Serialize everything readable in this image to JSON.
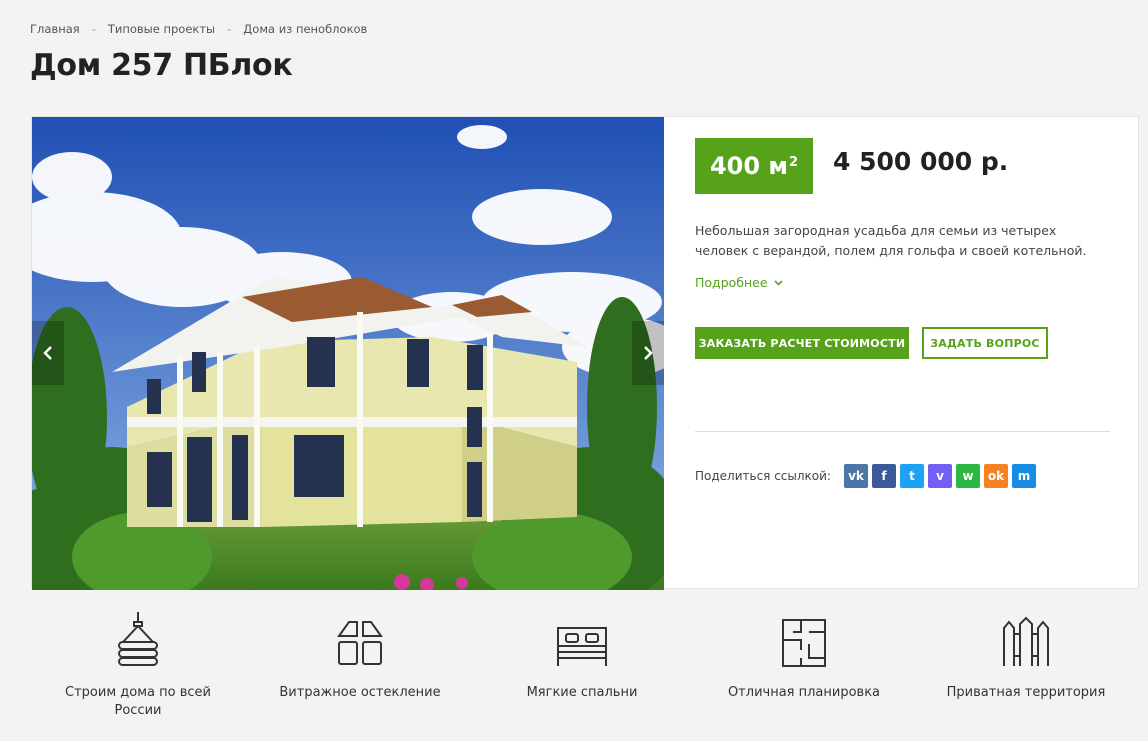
{
  "breadcrumb": [
    "Главная",
    "Типовые проекты",
    "Дома из пеноблоков"
  ],
  "title": "Дом 257 ПБлок",
  "area": "400 м",
  "area_sup": "2",
  "price": "4 500 000 р.",
  "description": "Небольшая загородная усадьба для семьи из четырех человек с верандой, полем для гольфа и своей котельной.",
  "more_label": "Подробнее",
  "buttons": {
    "order": "ЗАКАЗАТЬ РАСЧЕТ СТОИМОСТИ",
    "ask": "ЗАДАТЬ ВОПРОС"
  },
  "share": {
    "label": "Поделиться ссылкой:",
    "networks": [
      {
        "name": "vk",
        "glyph": "vk",
        "color": "#4a76a8"
      },
      {
        "name": "facebook",
        "glyph": "f",
        "color": "#3b5998"
      },
      {
        "name": "twitter",
        "glyph": "t",
        "color": "#1da1f2"
      },
      {
        "name": "viber",
        "glyph": "v",
        "color": "#7360f2"
      },
      {
        "name": "whatsapp",
        "glyph": "w",
        "color": "#2cb742"
      },
      {
        "name": "odnoklassniki",
        "glyph": "ok",
        "color": "#f58220"
      },
      {
        "name": "moimir",
        "glyph": "m",
        "color": "#168de2"
      }
    ]
  },
  "features": [
    {
      "icon": "crane-logs-icon",
      "label": "Строим дома по всей России"
    },
    {
      "icon": "window-glazing-icon",
      "label": "Витражное остекление"
    },
    {
      "icon": "bed-icon",
      "label": "Мягкие спальни"
    },
    {
      "icon": "floor-plan-icon",
      "label": "Отличная планировка"
    },
    {
      "icon": "fence-icon",
      "label": "Приватная территория"
    }
  ],
  "colors": {
    "accent": "#56a21a"
  }
}
